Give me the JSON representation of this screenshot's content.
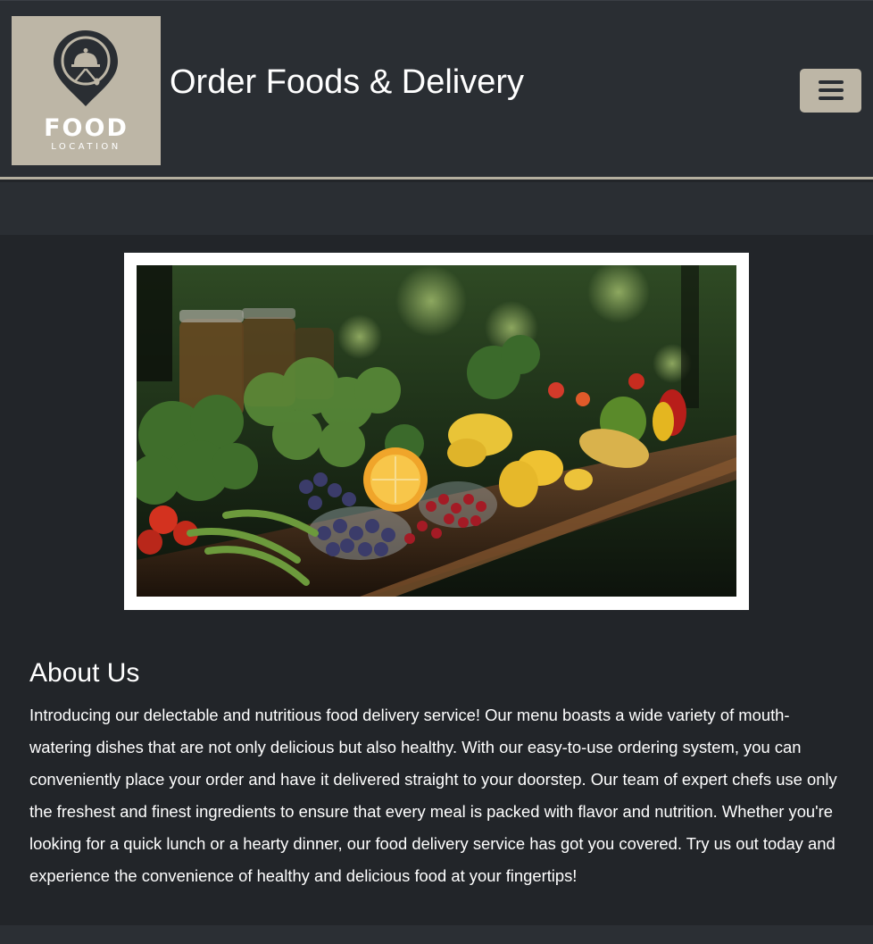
{
  "brand": {
    "logo_line1": "FOOD",
    "logo_line2": "LOCATION",
    "logo_background": "#bdb6a6"
  },
  "header": {
    "title": "Order Foods & Delivery",
    "menu_icon": "hamburger-icon"
  },
  "hero": {
    "description_icon": "fresh-produce-photo"
  },
  "about": {
    "heading": "About Us",
    "body": "Introducing our delectable and nutritious food delivery service! Our menu boasts a wide variety of mouth-watering dishes that are not only delicious but also healthy. With our easy-to-use ordering system, you can conveniently place your order and have it delivered straight to your doorstep. Our team of expert chefs use only the freshest and finest ingredients to ensure that every meal is packed with flavor and nutrition. Whether you're looking for a quick lunch or a hearty dinner, our food delivery service has got you covered. Try us out today and experience the convenience of healthy and delicious food at your fingertips!"
  },
  "colors": {
    "page_background": "#222529",
    "header_background": "#2a2e33",
    "accent": "#bdb6a6"
  }
}
